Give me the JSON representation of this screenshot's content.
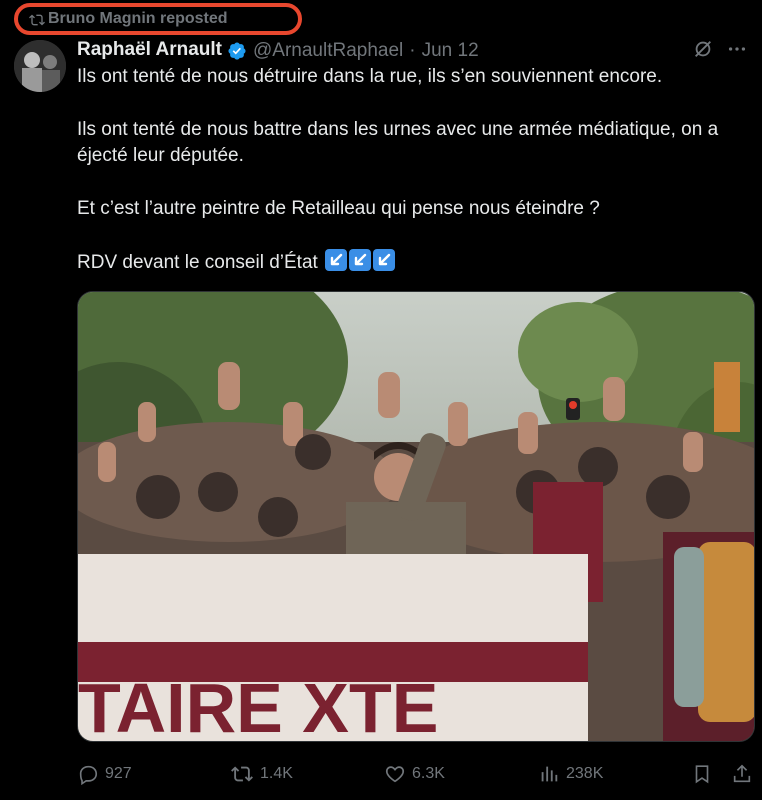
{
  "repost": {
    "label": "Bruno Magnin reposted",
    "icon": "retweet-icon",
    "highlight_color": "#e8472e"
  },
  "author": {
    "name": "Raphaël Arnault",
    "handle": "@ArnaultRaphael",
    "separator": "·",
    "date": "Jun 12",
    "verified_color": "#1d9bf0"
  },
  "tweet": {
    "line1": "Ils ont tenté de nous détruire dans la rue, ils s’en souviennent encore.",
    "line2": "Ils ont tenté de nous battre dans les urnes avec une armée médiatique, on a éjecté leur députée.",
    "line3": "Et c’est l’autre peintre de Retailleau qui pense nous éteindre ?",
    "line4": "RDV devant le conseil d’État",
    "emojis": [
      "arrow-down-left-emoji",
      "arrow-down-left-emoji",
      "arrow-down-left-emoji"
    ]
  },
  "media": {
    "banner_text": "TAIRE   XTE"
  },
  "actions": {
    "replies": "927",
    "reposts": "1.4K",
    "likes": "6.3K",
    "views": "238K"
  },
  "colors": {
    "background": "#000000",
    "text": "#e7e9ea",
    "muted": "#71767b",
    "accent": "#1d9bf0"
  }
}
